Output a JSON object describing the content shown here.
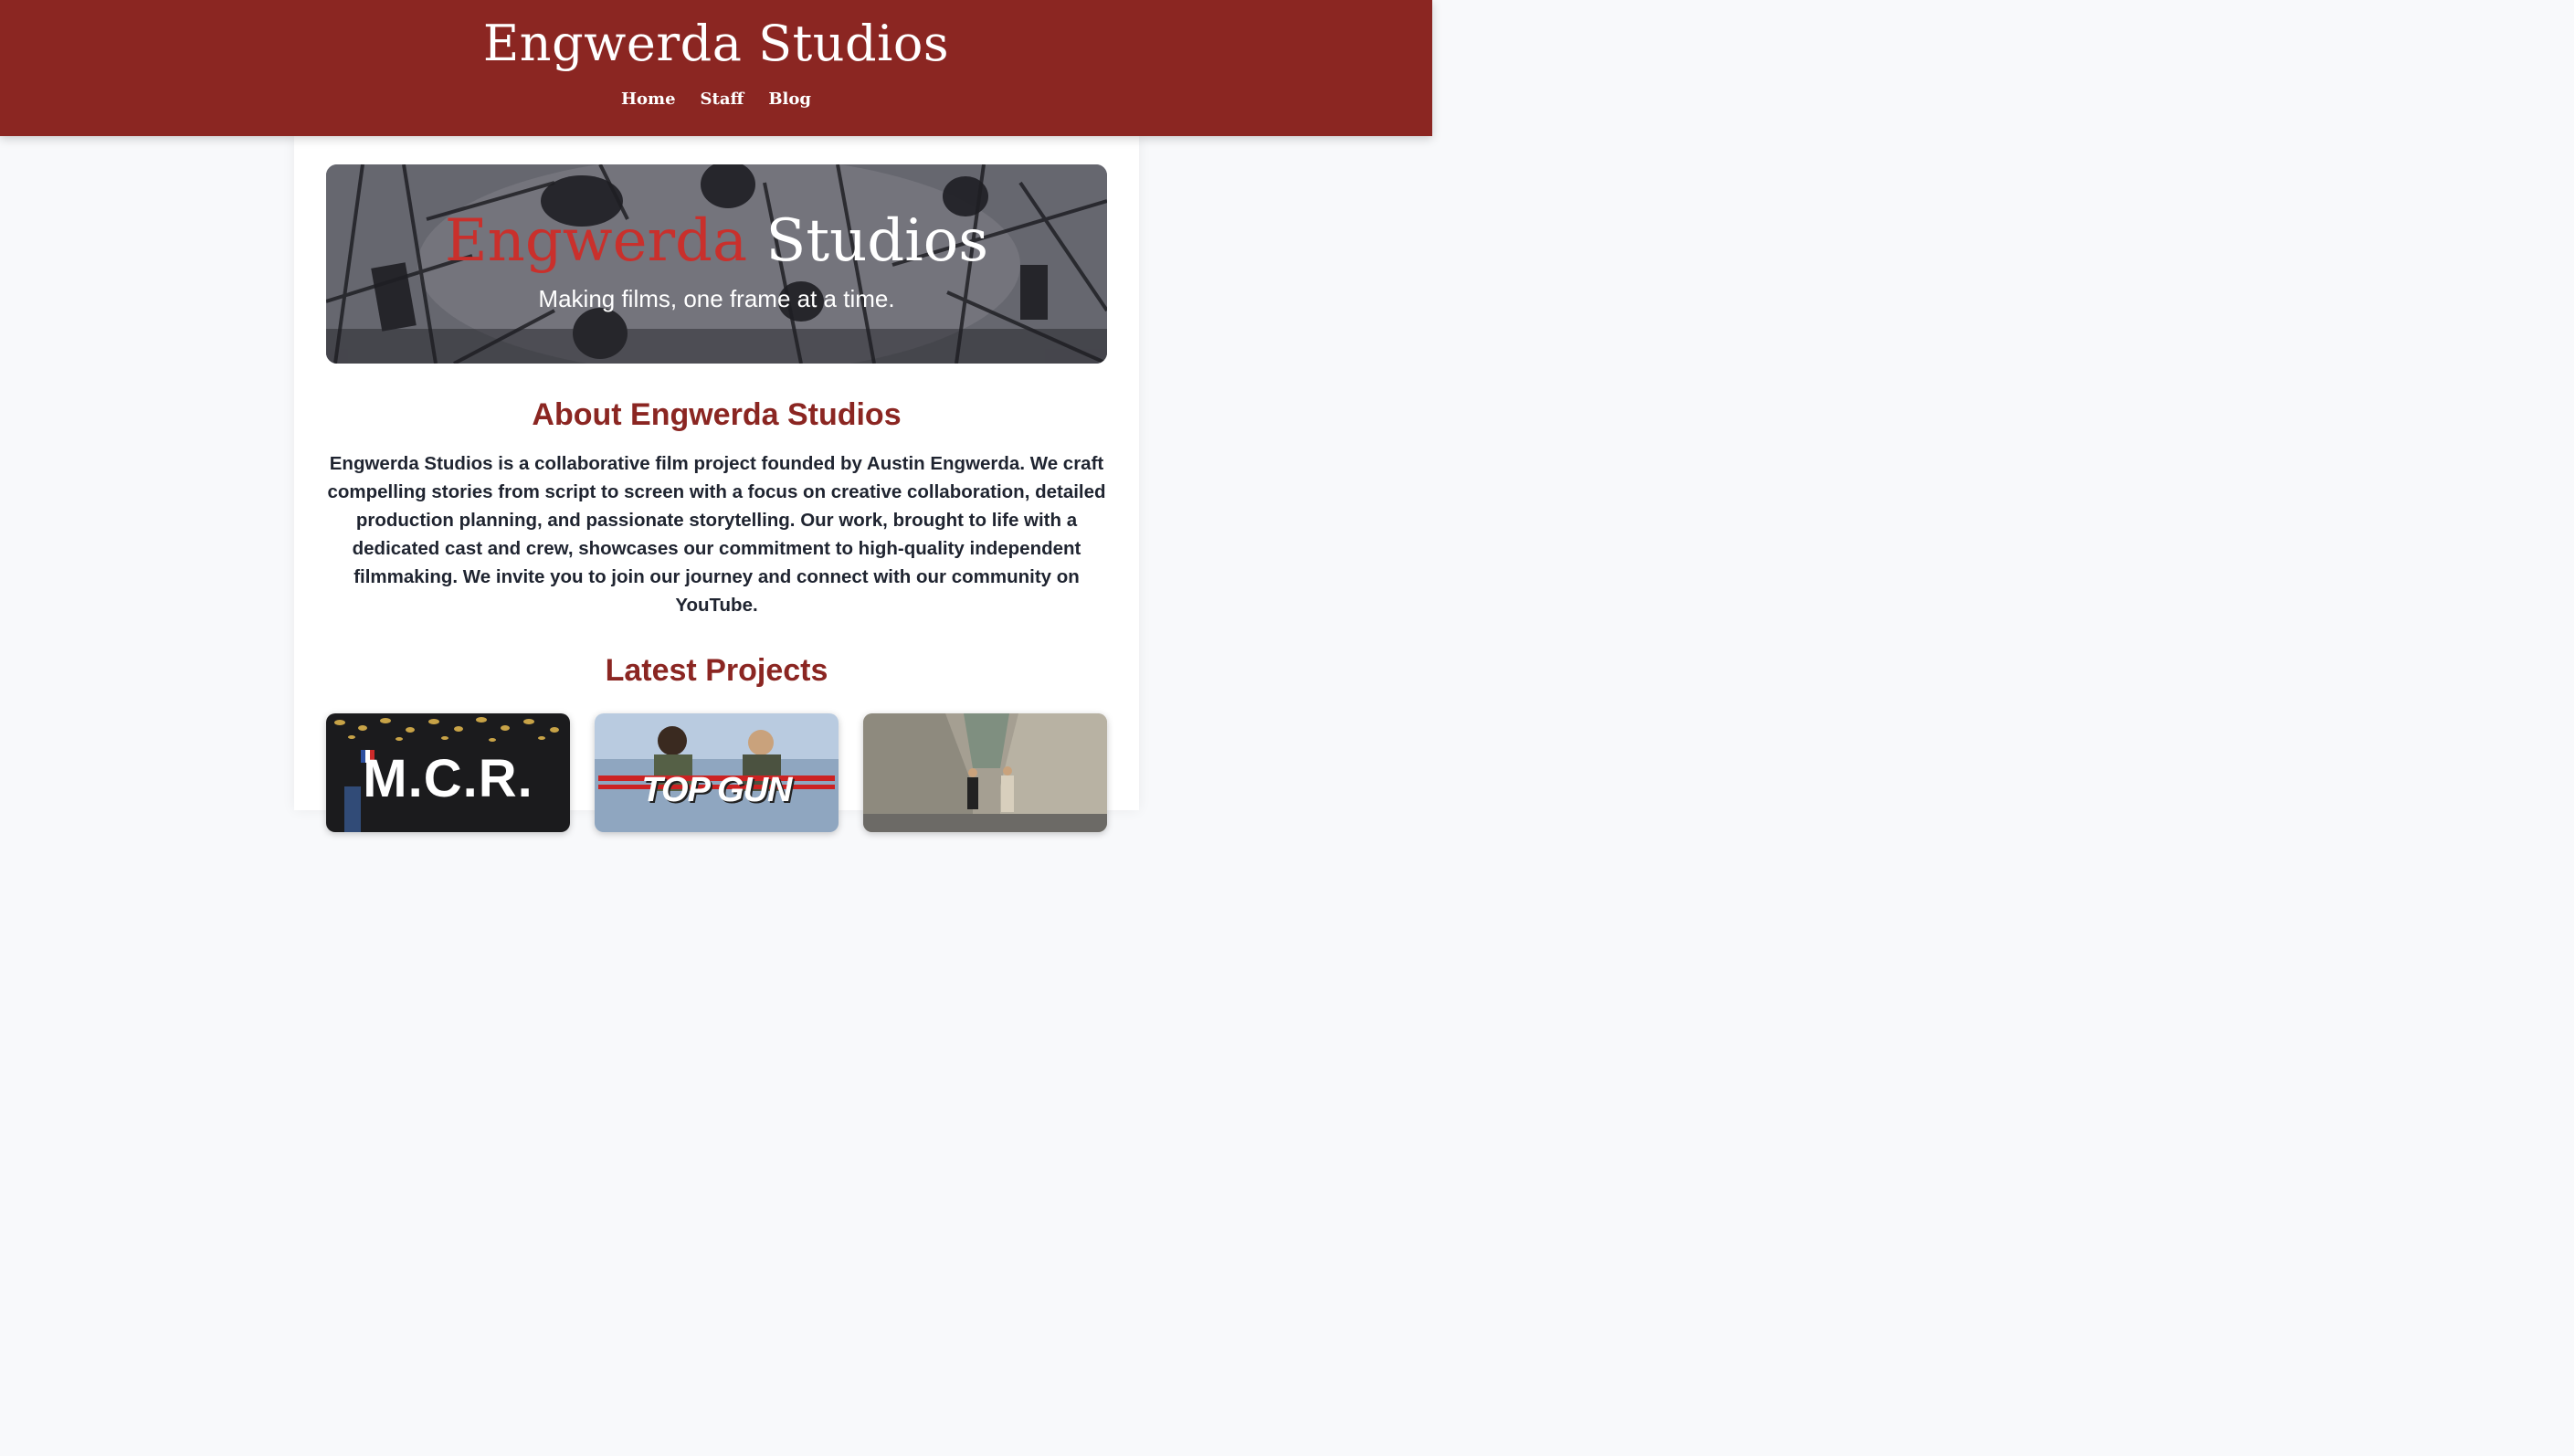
{
  "header": {
    "site_title": "Engwerda Studios",
    "nav": [
      {
        "label": "Home"
      },
      {
        "label": "Staff"
      },
      {
        "label": "Blog"
      }
    ]
  },
  "hero": {
    "title_first": "Engwerda",
    "title_second": "Studios",
    "tagline": "Making films, one frame at a time."
  },
  "about": {
    "heading": "About Engwerda Studios",
    "body": "Engwerda Studios is a collaborative film project founded by Austin Engwerda. We craft compelling stories from script to screen with a focus on creative collaboration, detailed production planning, and passionate storytelling. Our work, brought to life with a dedicated cast and crew, showcases our commitment to high-quality independent filmmaking. We invite you to join our journey and connect with our community on YouTube."
  },
  "projects": {
    "heading": "Latest Projects",
    "items": [
      {
        "poster_text": "M.C.R."
      },
      {
        "poster_text": "TOP GUN"
      },
      {
        "poster_text": ""
      }
    ]
  },
  "colors": {
    "brand": "#8b2622",
    "accent": "#c9302c",
    "text": "#1f2430"
  }
}
